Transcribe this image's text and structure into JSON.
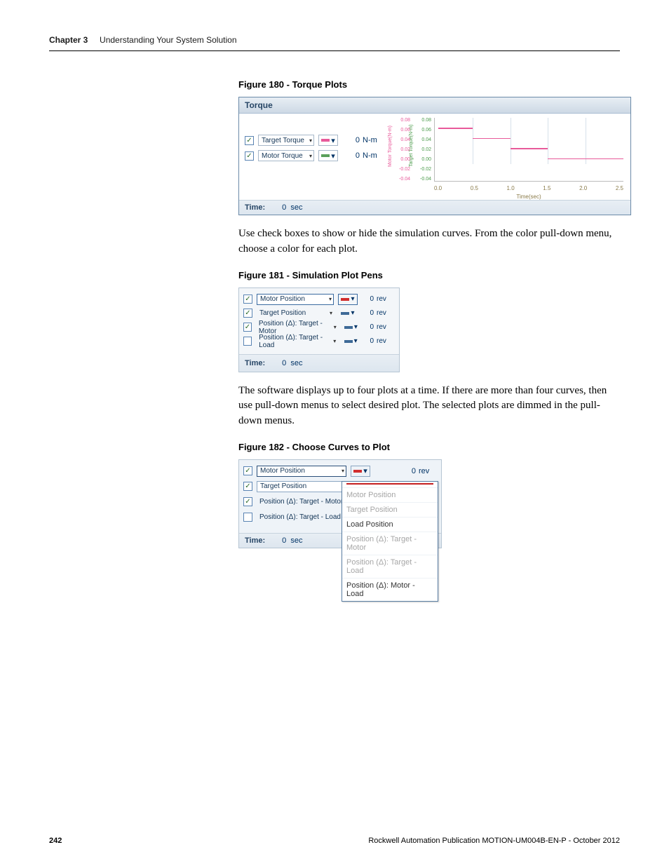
{
  "header": {
    "chapter": "Chapter 3",
    "title": "Understanding Your System Solution"
  },
  "fig180": {
    "caption": "Figure 180 - Torque Plots",
    "panelTitle": "Torque",
    "rows": [
      {
        "label": "Target Torque",
        "color": "#e85a9a",
        "value": "0",
        "unit": "N-m",
        "checked": true
      },
      {
        "label": "Motor Torque",
        "color": "#5aa05a",
        "value": "0",
        "unit": "N-m",
        "checked": true
      }
    ],
    "timeLabel": "Time:",
    "timeValue": "0",
    "timeUnit": "sec",
    "y1label": "Motor Torque(N-m)",
    "y2label": "Target Torque(N-m)",
    "yticks": [
      "0.08",
      "0.06",
      "0.04",
      "0.02",
      "0.00",
      "-0.02",
      "-0.04"
    ],
    "xticks": [
      "0.0",
      "0.5",
      "1.0",
      "1.5",
      "2.0",
      "2.5"
    ],
    "xlabel": "Time(sec)"
  },
  "para1": "Use check boxes to show or hide the simulation curves. From the color pull-down menu, choose a color for each plot.",
  "fig181": {
    "caption": "Figure 181 - Simulation Plot Pens",
    "rows": [
      {
        "label": "Motor Position",
        "color": "#d12d2d",
        "value": "0",
        "unit": "rev",
        "checked": true,
        "boxed": true
      },
      {
        "label": "Target Position",
        "color": "#3e6a97",
        "value": "0",
        "unit": "rev",
        "checked": true,
        "boxed": false
      },
      {
        "label": "Position (Δ): Target - Motor",
        "color": "#3e6a97",
        "value": "0",
        "unit": "rev",
        "checked": true,
        "boxed": false
      },
      {
        "label": "Position (Δ): Target - Load",
        "color": "#3e6a97",
        "value": "0",
        "unit": "rev",
        "checked": false,
        "boxed": false
      }
    ],
    "timeLabel": "Time:",
    "timeValue": "0",
    "timeUnit": "sec"
  },
  "para2": "The software displays up to four plots at a time. If there are more than four curves, then use pull-down menus to select desired plot. The selected plots are dimmed in the pull-down menus.",
  "fig182": {
    "caption": "Figure 182 - Choose Curves to Plot",
    "rows": [
      {
        "label": "Motor Position",
        "color": "#d12d2d",
        "value": "0",
        "unit": "rev",
        "checked": true
      },
      {
        "label": "Target Position",
        "checked": true
      },
      {
        "label": "Position (Δ): Target - Motor",
        "checked": true
      },
      {
        "label": "Position (Δ): Target - Load",
        "checked": false
      }
    ],
    "menu": [
      {
        "t": "Motor Position",
        "dim": true
      },
      {
        "t": "Target Position",
        "dim": true
      },
      {
        "t": "Load Position",
        "dim": false
      },
      {
        "t": "Position (Δ): Target - Motor",
        "dim": true
      },
      {
        "t": "Position (Δ): Target - Load",
        "dim": true
      },
      {
        "t": "Position (Δ): Motor - Load",
        "dim": false
      }
    ],
    "timeLabel": "Time:",
    "timeValue": "0",
    "timeUnit": "sec"
  },
  "chart_data": {
    "type": "line",
    "title": "Torque",
    "xlabel": "Time(sec)",
    "x": [
      0.0,
      0.5,
      1.0,
      1.5,
      2.0,
      2.5
    ],
    "series": [
      {
        "name": "Motor Torque",
        "ylabel": "Motor Torque(N-m)",
        "ylim": [
          -0.04,
          0.08
        ],
        "points": [
          [
            0.0,
            0.0
          ],
          [
            0.05,
            0.06
          ],
          [
            0.5,
            0.06
          ],
          [
            0.5,
            0.04
          ],
          [
            1.0,
            0.04
          ],
          [
            1.0,
            0.02
          ],
          [
            1.5,
            0.02
          ],
          [
            1.5,
            0.0
          ],
          [
            2.5,
            0.0
          ]
        ]
      },
      {
        "name": "Target Torque",
        "ylabel": "Target Torque(N-m)",
        "ylim": [
          -0.04,
          0.08
        ],
        "points": [
          [
            0.0,
            0.0
          ],
          [
            0.05,
            0.06
          ],
          [
            0.5,
            0.06
          ],
          [
            0.5,
            0.04
          ],
          [
            1.0,
            0.04
          ],
          [
            1.0,
            0.02
          ],
          [
            1.5,
            0.02
          ],
          [
            1.5,
            0.0
          ],
          [
            2.5,
            0.0
          ]
        ]
      }
    ]
  },
  "footer": {
    "page": "242",
    "pub": "Rockwell Automation Publication MOTION-UM004B-EN-P - October 2012"
  }
}
